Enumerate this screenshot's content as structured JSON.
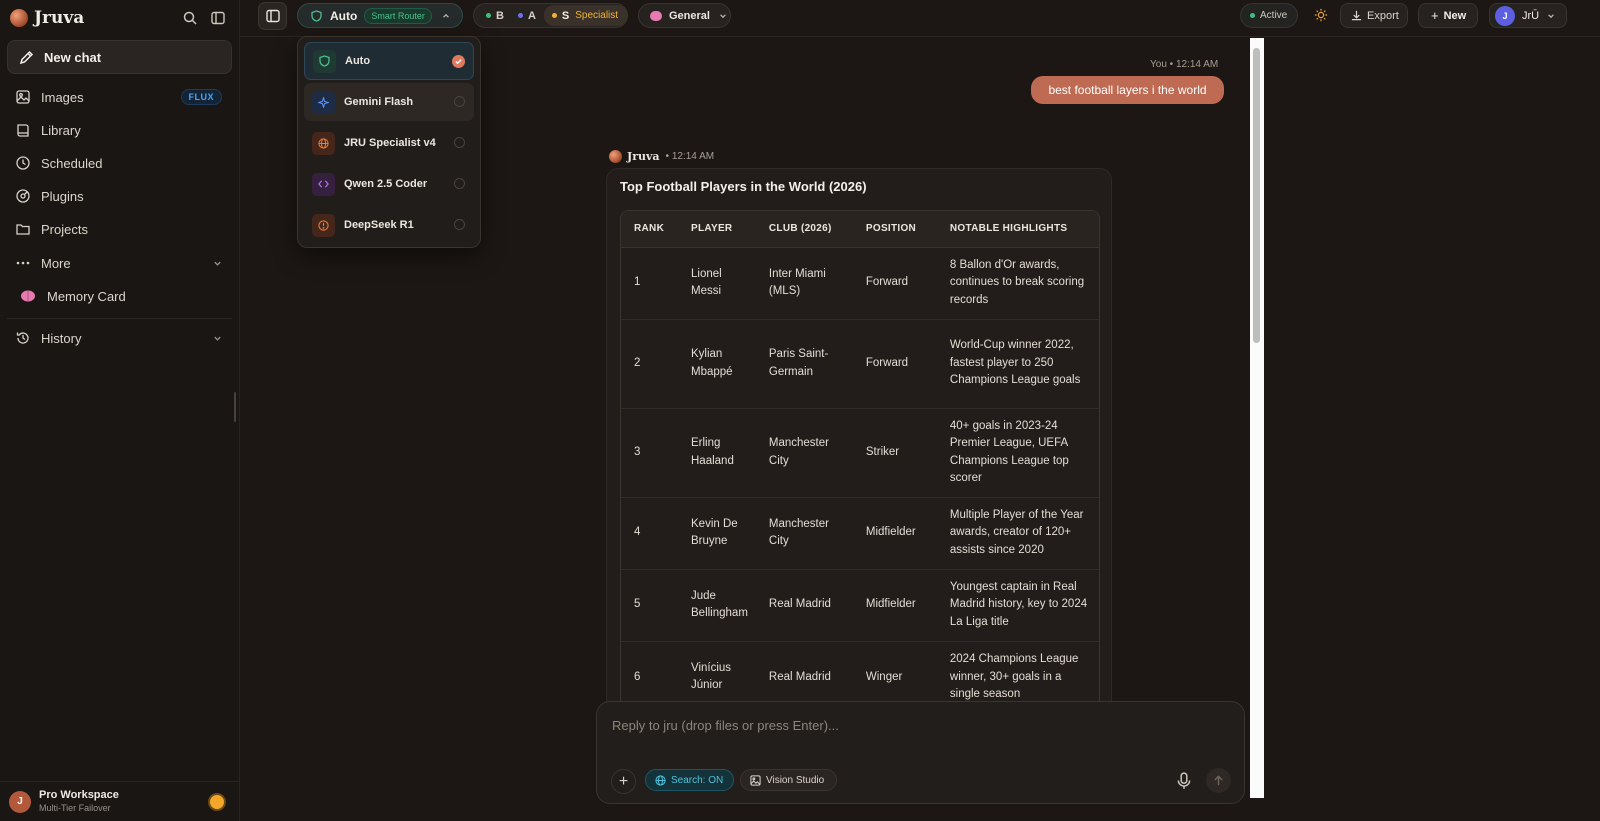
{
  "sidebar": {
    "brand": "Jruva",
    "new_chat": "New chat",
    "items": [
      {
        "label": "Images",
        "badge": "FLUX",
        "icon": "image-icon"
      },
      {
        "label": "Library",
        "icon": "book-icon"
      },
      {
        "label": "Scheduled",
        "icon": "clock-icon"
      },
      {
        "label": "Plugins",
        "icon": "plugin-icon"
      },
      {
        "label": "Projects",
        "icon": "folder-icon"
      },
      {
        "label": "More",
        "icon": "more-icon"
      },
      {
        "label": "Memory Card",
        "icon": "brain-icon"
      },
      {
        "label": "History",
        "icon": "history-icon"
      }
    ],
    "workspace": {
      "avatar": "J",
      "name": "Pro Workspace",
      "subtitle": "Multi-Tier Failover"
    }
  },
  "topbar": {
    "router_label": "Auto",
    "router_badge": "Smart Router",
    "tiers": [
      {
        "letter": "B",
        "color": "#3fbf7f"
      },
      {
        "letter": "A",
        "color": "#6f6ff0"
      },
      {
        "letter": "S",
        "label": "Specialist",
        "color": "#f0b236"
      }
    ],
    "mode": "General",
    "status": "Active",
    "export": "Export",
    "new": "New",
    "user_avatar": "J",
    "user_name": "JrŪ"
  },
  "model_menu": {
    "items": [
      {
        "label": "Auto",
        "icon": "shield-icon",
        "selected": true
      },
      {
        "label": "Gemini Flash",
        "icon": "sparkle-icon",
        "selected": false
      },
      {
        "label": "JRU Specialist v4",
        "icon": "globe-icon",
        "selected": false
      },
      {
        "label": "Qwen 2.5 Coder",
        "icon": "code-icon",
        "selected": false
      },
      {
        "label": "DeepSeek R1",
        "icon": "info-icon",
        "selected": false
      }
    ]
  },
  "conversation": {
    "user_name": "You",
    "user_time": "12:14 AM",
    "user_message": "best football layers i the world",
    "ai_name": "Jruva",
    "ai_time": "12:14 AM",
    "ai_title": "Top Football Players in the World (2026)",
    "table": {
      "headers": [
        "RANK",
        "PLAYER",
        "CLUB (2026)",
        "POSITION",
        "NOTABLE HIGHLIGHTS"
      ],
      "rows": [
        [
          "1",
          "Lionel Messi",
          "Inter Miami (MLS)",
          "Forward",
          "8 Ballon d'Or awards, continues to break scoring records"
        ],
        [
          "2",
          "Kylian Mbappé",
          "Paris Saint-Germain",
          "Forward",
          "World-Cup winner 2022, fastest player to 250 Champions League goals"
        ],
        [
          "3",
          "Erling Haaland",
          "Manchester City",
          "Striker",
          "40+ goals in 2023-24 Premier League, UEFA Champions League top scorer"
        ],
        [
          "4",
          "Kevin De Bruyne",
          "Manchester City",
          "Midfielder",
          "Multiple Player of the Year awards, creator of 120+ assists since 2020"
        ],
        [
          "5",
          "Jude Bellingham",
          "Real Madrid",
          "Midfielder",
          "Youngest captain in Real Madrid history, key to 2024 La Liga title"
        ],
        [
          "6",
          "Vinícius Júnior",
          "Real Madrid",
          "Winger",
          "2024 Champions League winner, 30+ goals in a single season"
        ]
      ]
    }
  },
  "composer": {
    "placeholder": "Reply to jru (drop files or press Enter)...",
    "search": "Search: ON",
    "vision": "Vision Studio"
  }
}
